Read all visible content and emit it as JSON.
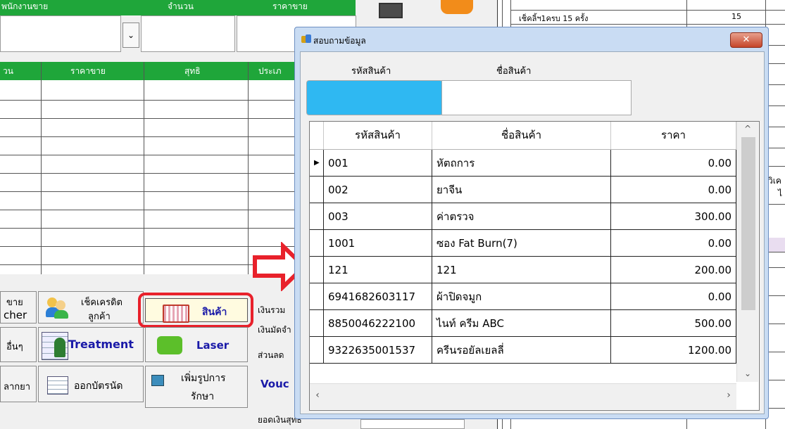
{
  "sale_header": {
    "col1": "พนักงานขาย",
    "col2": "จำนวน",
    "col3": "ราคาขาย"
  },
  "detail_header": {
    "col0": "วน",
    "col1": "ราคาขาย",
    "col2": "สุทธิ",
    "col3": "ประเภ"
  },
  "buttons": {
    "sale_voucher_line1": "ขาย",
    "sale_voucher_line2": "cher",
    "check_credit_line1": "เช็คเครดิต",
    "check_credit_line2": "ลูกค้า",
    "products": "สินค้า",
    "other": "อื่นๆ",
    "treatment": "Treatment",
    "laser": "Laser",
    "drug": "ลากยา",
    "appointment": "ออกบัตรนัด",
    "add_treatment_line1": "เพิ่มรูปการ",
    "add_treatment_line2": "รักษา"
  },
  "summary_labels": {
    "total": "เงินรวม",
    "deposit": "เงินมัดจำ",
    "discount": "ส่วนลด",
    "voucher": "Vouc",
    "net": "ยอดเงินสุทธิ"
  },
  "right_panel": {
    "row_text": "เช็คลิ้ฯ1ครบ 15 ครั้ง",
    "row_num": "15",
    "side_label1": "วิเค",
    "side_label2": "ไ"
  },
  "dialog": {
    "title": "สอบถามข้อมูล",
    "label_code": "รหัสสินค้า",
    "label_name": "ชื่อสินค้า",
    "code_value": "",
    "name_value": "",
    "columns": [
      "รหัสสินค้า",
      "ชื่อสินค้า",
      "ราคา"
    ],
    "rows": [
      {
        "code": "001",
        "name": "หัตถการ",
        "price": "0.00"
      },
      {
        "code": "002",
        "name": "ยาจีน",
        "price": "0.00"
      },
      {
        "code": "003",
        "name": "ค่าตรวจ",
        "price": "300.00"
      },
      {
        "code": "1001",
        "name": "ซอง Fat Burn(7)",
        "price": "0.00"
      },
      {
        "code": "121",
        "name": "121",
        "price": "200.00"
      },
      {
        "code": "6941682603117",
        "name": "ผ้าปิดจมูก",
        "price": "0.00"
      },
      {
        "code": "8850046222100",
        "name": "ไนท์ ครีม ABC",
        "price": "500.00"
      },
      {
        "code": "9322635001537",
        "name": "ครีนรอยัลเยลลี่",
        "price": "1200.00"
      }
    ]
  },
  "colors": {
    "green": "#1fa63a",
    "highlight_red": "#e8212b",
    "arrow_red": "#e8212b",
    "code_field_blue": "#2fb8f2"
  }
}
